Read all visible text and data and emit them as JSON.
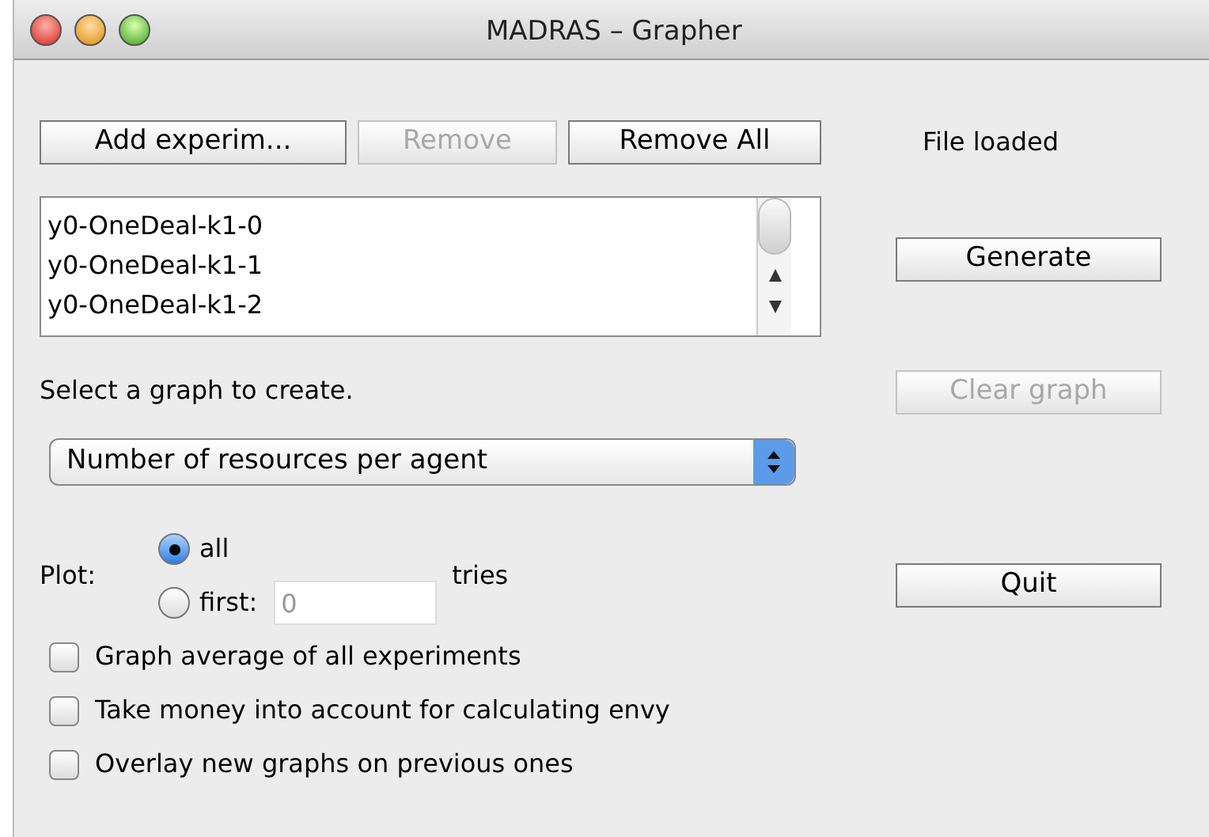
{
  "window": {
    "title": "MADRAS – Grapher"
  },
  "top_buttons": [
    {
      "label": "Add experim...",
      "disabled": false
    },
    {
      "label": "Remove",
      "disabled": true
    },
    {
      "label": "Remove All",
      "disabled": false
    }
  ],
  "status": "File loaded",
  "experiments": [
    "y0-OneDeal-k1-0",
    "y0-OneDeal-k1-1",
    "y0-OneDeal-k1-2"
  ],
  "graph_prompt": "Select a graph to create.",
  "graph_select": {
    "value": "Number of resources per agent"
  },
  "plot": {
    "label": "Plot:",
    "suffix": "tries",
    "options": [
      {
        "label": "all",
        "selected": true
      },
      {
        "label": "first:",
        "selected": false
      }
    ],
    "count_field": {
      "placeholder": "0"
    }
  },
  "options": [
    {
      "label": "Graph average of all experiments",
      "checked": false
    },
    {
      "label": "Take money into account for calculating envy",
      "checked": false
    },
    {
      "label": "Overlay new graphs on previous ones",
      "checked": false
    }
  ],
  "side_buttons": [
    {
      "label": "Generate",
      "disabled": false
    },
    {
      "label": "Clear graph",
      "disabled": true
    },
    {
      "label": "Quit",
      "disabled": false
    }
  ]
}
